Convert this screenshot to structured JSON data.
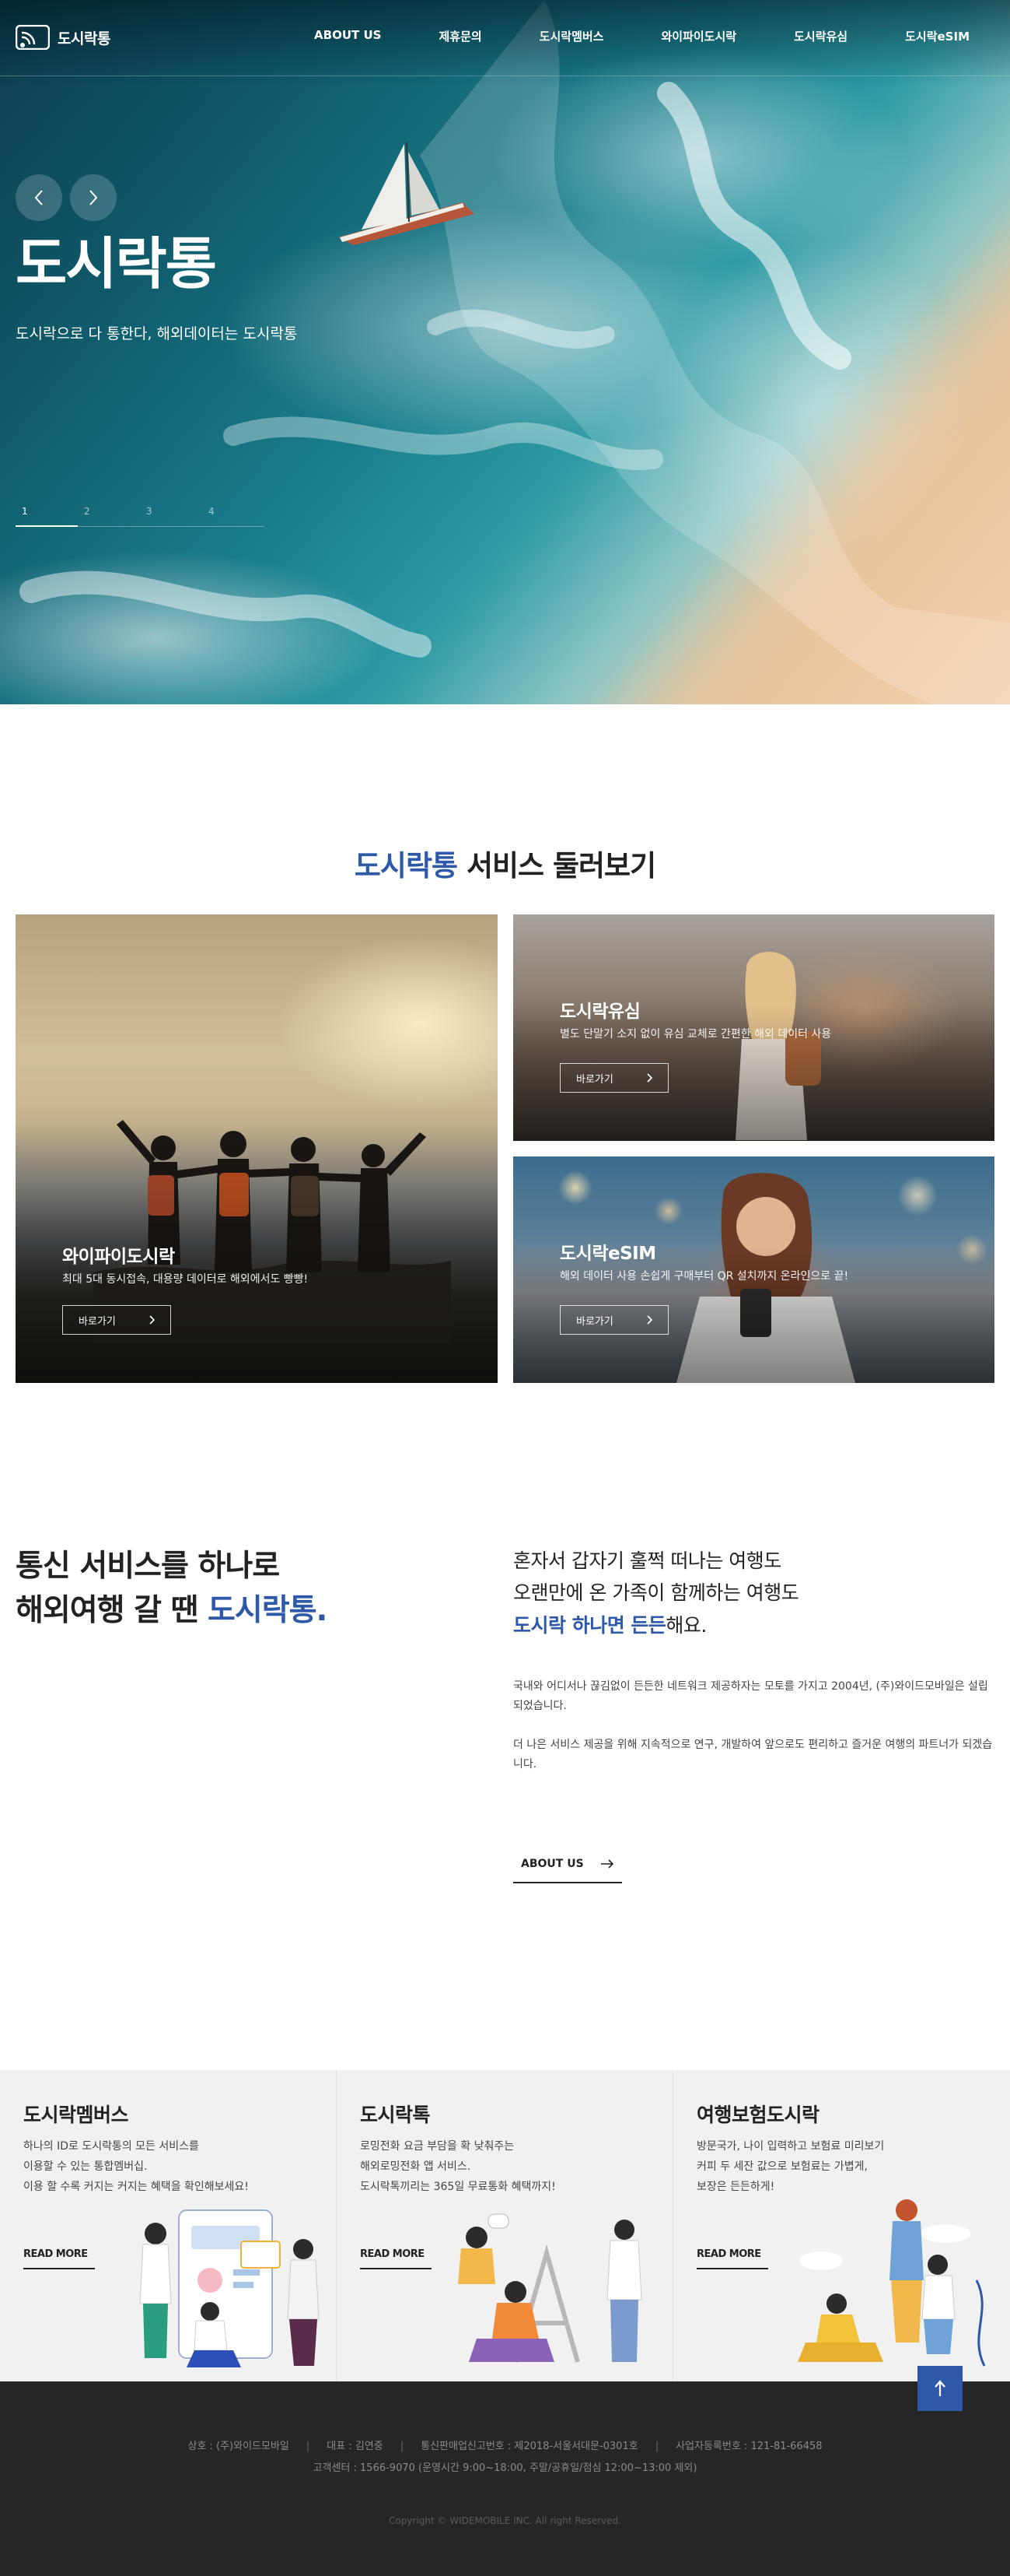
{
  "brand": {
    "logo_text": "도시락통"
  },
  "nav": [
    {
      "label": "ABOUT US"
    },
    {
      "label": "제휴문의"
    },
    {
      "label": "도시락멤버스"
    },
    {
      "label": "와이파이도시락"
    },
    {
      "label": "도시락유심"
    },
    {
      "label": "도시락eSIM"
    }
  ],
  "hero": {
    "title": "도시락통",
    "subtitle": "도시락으로 다 통한다, 해외데이터는 도시락통",
    "pager": [
      "1",
      "2",
      "3",
      "4"
    ],
    "active_page": 1,
    "progress": 0.25
  },
  "services": {
    "title_accent": "도시락통",
    "title_rest": " 서비스 둘러보기",
    "cards": [
      {
        "name": "와이파이도시락",
        "desc": "최대 5대 동시접속, 대용량 데이터로 해외에서도 빵빵!",
        "button": "바로가기"
      },
      {
        "name": "도시락유심",
        "desc": "별도 단말기 소지 없이 유심 교체로 간편한 해외 데이터 사용",
        "button": "바로가기"
      },
      {
        "name": "도시락eSIM",
        "desc": "해외 데이터 사용 손쉽게 구매부터 QR 설치까지 온라인으로 끝!",
        "button": "바로가기"
      }
    ]
  },
  "about": {
    "heading_line1": "통신 서비스를 하나로",
    "heading_line2_plain": "해외여행 갈 땐 ",
    "heading_line2_accent": "도시락통.",
    "lead_line1": "혼자서 갑자기 훌쩍 떠나는 여행도",
    "lead_line2": "오랜만에 온 가족이 함께하는 여행도",
    "lead_line3_accent": "도시락 하나면 든든",
    "lead_line3_rest": "해요.",
    "paragraph1": "국내와 어디서나 끊김없이 든든한 네트워크 제공하자는 모토를 가지고 2004년, (주)와이드모바일은 설립되었습니다.",
    "paragraph2": "더 나은 서비스 제공을 위해 지속적으로 연구, 개발하여 앞으로도 편리하고 즐거운 여행의 파트너가 되겠습니다.",
    "button": "ABOUT US"
  },
  "features": [
    {
      "title": "도시락멤버스",
      "lines": [
        "하나의 ID로 도시락통의 모든 서비스를",
        "이용할 수 있는 통합멤버십.",
        "이용 할 수록 커지는 커지는 혜택을 확인해보세요!"
      ],
      "more": "READ MORE"
    },
    {
      "title": "도시락톡",
      "lines": [
        "로밍전화 요금 부담을 확 낮춰주는",
        "해외로밍전화 앱 서비스.",
        "도시락톡끼리는 365일 무료통화 혜택까지!"
      ],
      "more": "READ MORE"
    },
    {
      "title": "여행보험도시락",
      "lines": [
        "방문국가, 나이 입력하고 보험료 미리보기",
        "커피 두 세잔 값으로 보험료는 가볍게,",
        "보장은 든든하게!"
      ],
      "more": "READ MORE"
    }
  ],
  "footer": {
    "company": "상호 : (주)와이드모바일",
    "ceo": "대표 : 김연중",
    "mail_order": "통신판매업신고번호 : 제2018-서울서대문-0301호",
    "biz_no": "사업자등록번호 : 121-81-66458",
    "cs": "고객센터 : 1566-9070 (운영시간 9:00~18:00, 주말/공휴일/점심 12:00~13:00 제외)",
    "copyright": "Copyright © WIDEMOBILE INC. All right Reserved."
  },
  "colors": {
    "accent": "#2d59a8",
    "footer_bg": "#262626",
    "feature_bg": "#f1f1f1"
  },
  "icons": [
    "logo-icon",
    "chevron-left-icon",
    "chevron-right-icon",
    "arrow-right-icon",
    "arrow-up-icon"
  ]
}
